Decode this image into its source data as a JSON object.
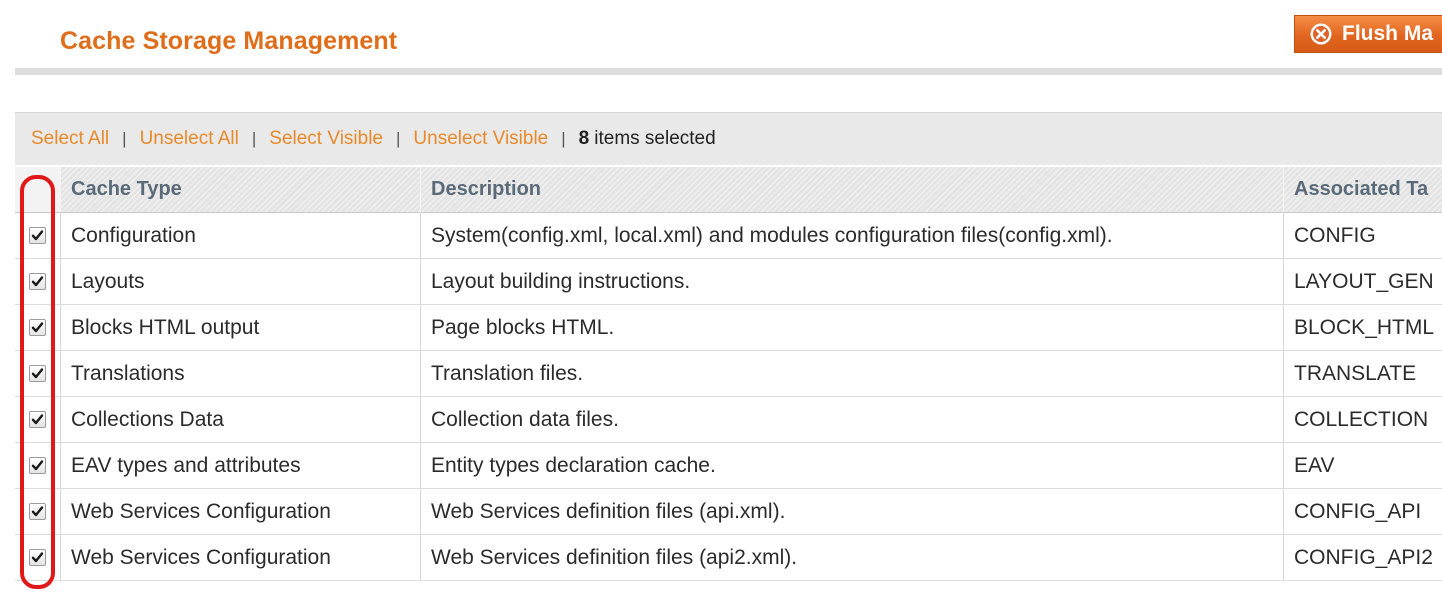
{
  "header": {
    "title": "Cache Storage Management",
    "flush_button_label": "Flush Ma"
  },
  "massaction": {
    "select_all": "Select All",
    "unselect_all": "Unselect All",
    "select_visible": "Select Visible",
    "unselect_visible": "Unselect Visible",
    "selected_count": "8",
    "selected_label": "items selected",
    "separator": "|"
  },
  "grid": {
    "columns": {
      "cache_type": "Cache Type",
      "description": "Description",
      "associated_tags": "Associated Ta"
    },
    "rows": [
      {
        "cache_type": "Configuration",
        "description": "System(config.xml, local.xml) and modules configuration files(config.xml).",
        "tags": "CONFIG",
        "checked": true
      },
      {
        "cache_type": "Layouts",
        "description": "Layout building instructions.",
        "tags": "LAYOUT_GEN",
        "checked": true
      },
      {
        "cache_type": "Blocks HTML output",
        "description": "Page blocks HTML.",
        "tags": "BLOCK_HTML",
        "checked": true
      },
      {
        "cache_type": "Translations",
        "description": "Translation files.",
        "tags": "TRANSLATE",
        "checked": true
      },
      {
        "cache_type": "Collections Data",
        "description": "Collection data files.",
        "tags": "COLLECTION",
        "checked": true
      },
      {
        "cache_type": "EAV types and attributes",
        "description": "Entity types declaration cache.",
        "tags": "EAV",
        "checked": true
      },
      {
        "cache_type": "Web Services Configuration",
        "description": "Web Services definition files (api.xml).",
        "tags": "CONFIG_API",
        "checked": true
      },
      {
        "cache_type": "Web Services Configuration",
        "description": "Web Services definition files (api2.xml).",
        "tags": "CONFIG_API2",
        "checked": true
      }
    ]
  },
  "colors": {
    "title": "#df6d1a",
    "link": "#e98a2a",
    "button": "#e1651f",
    "highlight": "#e01818"
  },
  "icons": {
    "flush": "close-circle-icon",
    "checkbox": "checkmark-icon"
  }
}
